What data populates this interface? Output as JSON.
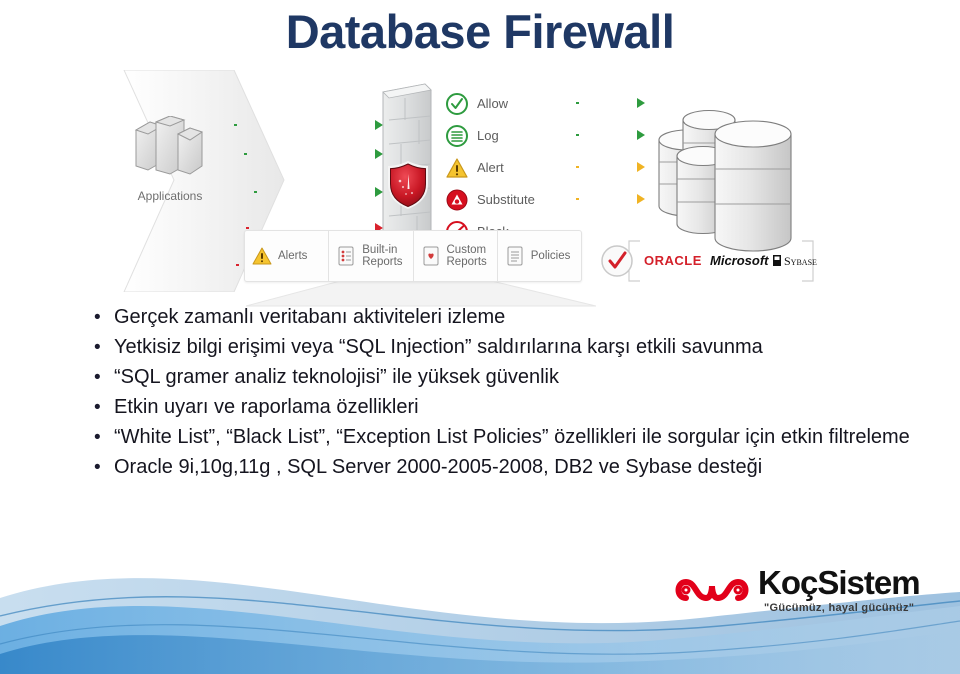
{
  "slide": {
    "title": "Database Firewall"
  },
  "diagram": {
    "source_label": "Applications",
    "actions": [
      {
        "icon": "check-circle-icon",
        "label": "Allow",
        "color": "#2e9b3f"
      },
      {
        "icon": "log-lines-icon",
        "label": "Log",
        "color": "#2e9b3f"
      },
      {
        "icon": "warning-triangle-icon",
        "label": "Alert",
        "color": "#f0b323"
      },
      {
        "icon": "substitute-icon",
        "label": "Substitute",
        "color": "#d9232e"
      },
      {
        "icon": "block-icon",
        "label": "Block",
        "color": "#d9232e"
      }
    ],
    "inbound_arrows": [
      {
        "color": "#2e9b3f",
        "kind": "allowed"
      },
      {
        "color": "#2e9b3f",
        "kind": "allowed"
      },
      {
        "color": "#2e9b3f",
        "kind": "allowed"
      },
      {
        "color": "#d9232e",
        "kind": "denied"
      },
      {
        "color": "#d9232e",
        "kind": "denied"
      }
    ],
    "outbound_arrows": [
      {
        "color": "#2e9b3f",
        "kind": "allow"
      },
      {
        "color": "#2e9b3f",
        "kind": "log"
      },
      {
        "color": "#f0b323",
        "kind": "alert"
      },
      {
        "color": "#f0b323",
        "kind": "substitute"
      }
    ],
    "toolbar": [
      {
        "icon": "alerts-icon",
        "line1": "Alerts",
        "line2": ""
      },
      {
        "icon": "built-in-report-icon",
        "line1": "Built-in",
        "line2": "Reports"
      },
      {
        "icon": "custom-report-icon",
        "line1": "Custom",
        "line2": "Reports"
      },
      {
        "icon": "policies-icon",
        "line1": "Policies",
        "line2": ""
      }
    ],
    "vendors": {
      "check_icon": "red-check-icon",
      "items": [
        "ORACLE",
        "Microsoft",
        "Sybase"
      ]
    }
  },
  "bullets": [
    {
      "marker": "•",
      "text": "Gerçek zamanlı veritabanı aktiviteleri izleme"
    },
    {
      "marker": "•",
      "text": "Yetkisiz bilgi erişimi veya “SQL Injection” saldırılarına karşı etkili savunma"
    },
    {
      "marker": "•",
      "text": "“SQL gramer analiz teknolojisi” ile yüksek güvenlik"
    },
    {
      "marker": "•",
      "text": "Etkin uyarı ve raporlama özellikleri"
    },
    {
      "marker": "•",
      "text": "“White List”, “Black List”, “Exception List Policies” özellikleri ile sorgular için etkin filtreleme"
    },
    {
      "marker": "•",
      "text": "Oracle 9i,10g,11g , SQL Server 2000-2005-2008, DB2 ve Sybase desteği"
    }
  ],
  "footer": {
    "logo_name": "KoçSistem",
    "logo_tagline": "\"Gücümüz, hayal gücünüz\""
  },
  "colors": {
    "title": "#1f3864",
    "body_text": "#15151f",
    "allow_green": "#2e9b3f",
    "deny_red": "#d9232e",
    "alert_yellow": "#f0b323",
    "brand_red": "#e2001a",
    "wave_blue": "#4a90d9"
  }
}
